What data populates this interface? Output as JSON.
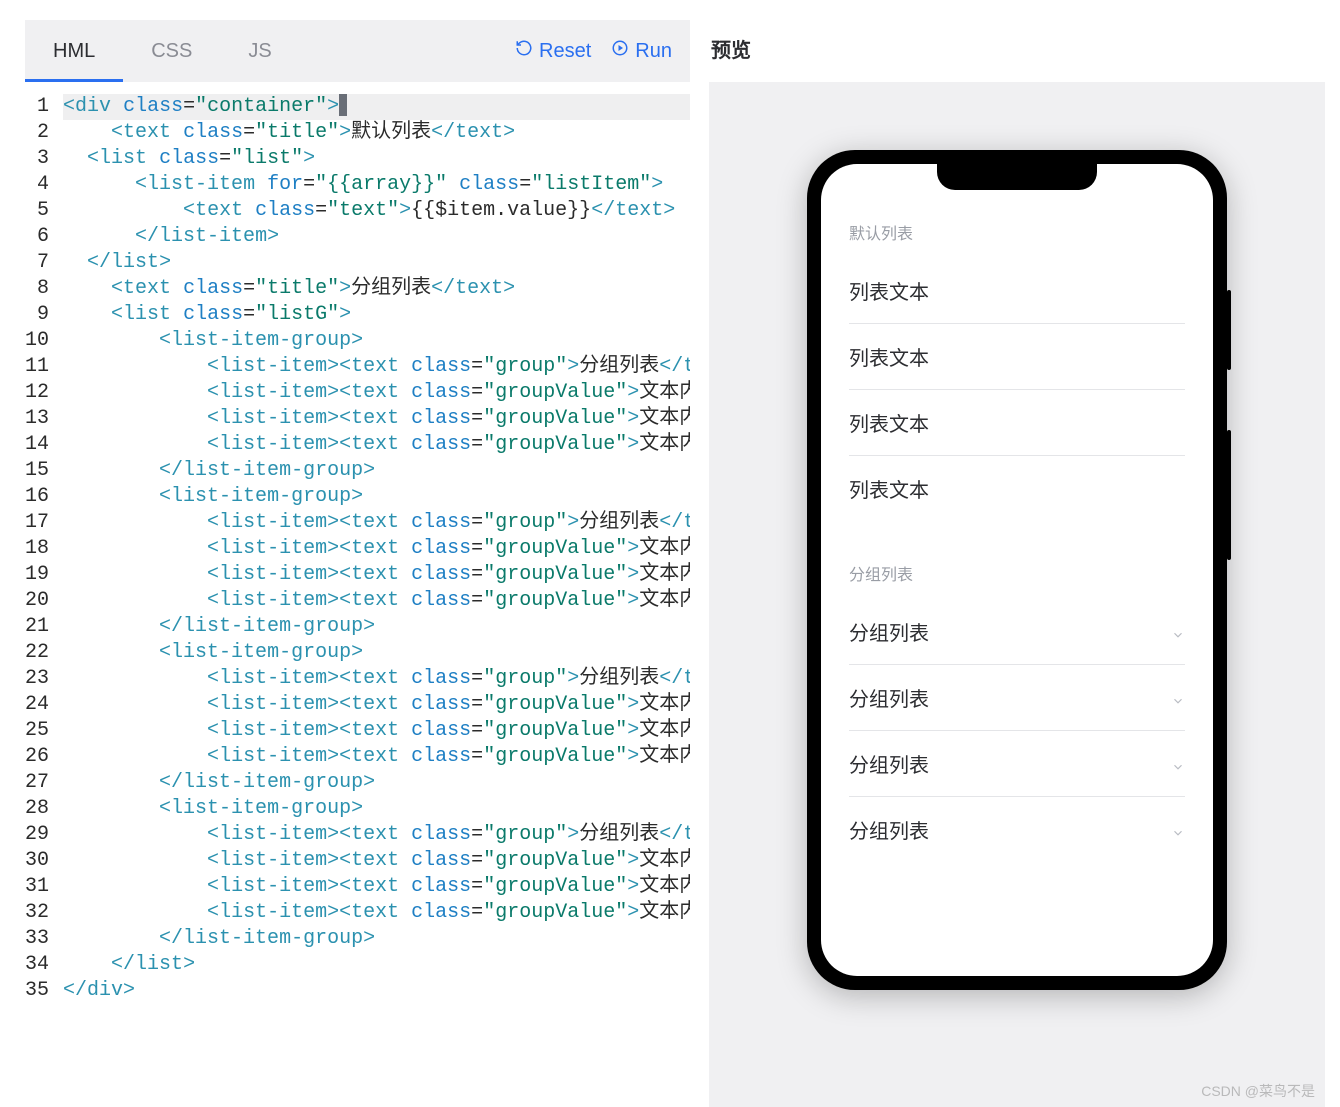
{
  "tabs": {
    "hml": "HML",
    "css": "CSS",
    "js": "JS"
  },
  "actions": {
    "reset": "Reset",
    "run": "Run"
  },
  "preview_label": "预览",
  "editor": {
    "lines": [
      "<div class=\"container\">",
      "    <text class=\"title\">默认列表</text>",
      "  <list class=\"list\">",
      "      <list-item for=\"{{array}}\" class=\"listItem\">",
      "          <text class=\"text\">{{$item.value}}</text>",
      "      </list-item>",
      "  </list>",
      "    <text class=\"title\">分组列表</text>",
      "    <list class=\"listG\">",
      "        <list-item-group>",
      "            <list-item><text class=\"group\">分组列表</te",
      "            <list-item><text class=\"groupValue\">文本内容",
      "            <list-item><text class=\"groupValue\">文本内容",
      "            <list-item><text class=\"groupValue\">文本内容",
      "        </list-item-group>",
      "        <list-item-group>",
      "            <list-item><text class=\"group\">分组列表</te",
      "            <list-item><text class=\"groupValue\">文本内容",
      "            <list-item><text class=\"groupValue\">文本内容",
      "            <list-item><text class=\"groupValue\">文本内容",
      "        </list-item-group>",
      "        <list-item-group>",
      "            <list-item><text class=\"group\">分组列表</te",
      "            <list-item><text class=\"groupValue\">文本内容",
      "            <list-item><text class=\"groupValue\">文本内容",
      "            <list-item><text class=\"groupValue\">文本内容",
      "        </list-item-group>",
      "        <list-item-group>",
      "            <list-item><text class=\"group\">分组列表</te",
      "            <list-item><text class=\"groupValue\">文本内容",
      "            <list-item><text class=\"groupValue\">文本内容",
      "            <list-item><text class=\"groupValue\">文本内容",
      "        </list-item-group>",
      "    </list>",
      "</div>"
    ]
  },
  "phone": {
    "section1_title": "默认列表",
    "list_items": [
      "列表文本",
      "列表文本",
      "列表文本",
      "列表文本"
    ],
    "section2_title": "分组列表",
    "group_items": [
      "分组列表",
      "分组列表",
      "分组列表",
      "分组列表"
    ]
  },
  "watermark": "CSDN @菜鸟不是"
}
